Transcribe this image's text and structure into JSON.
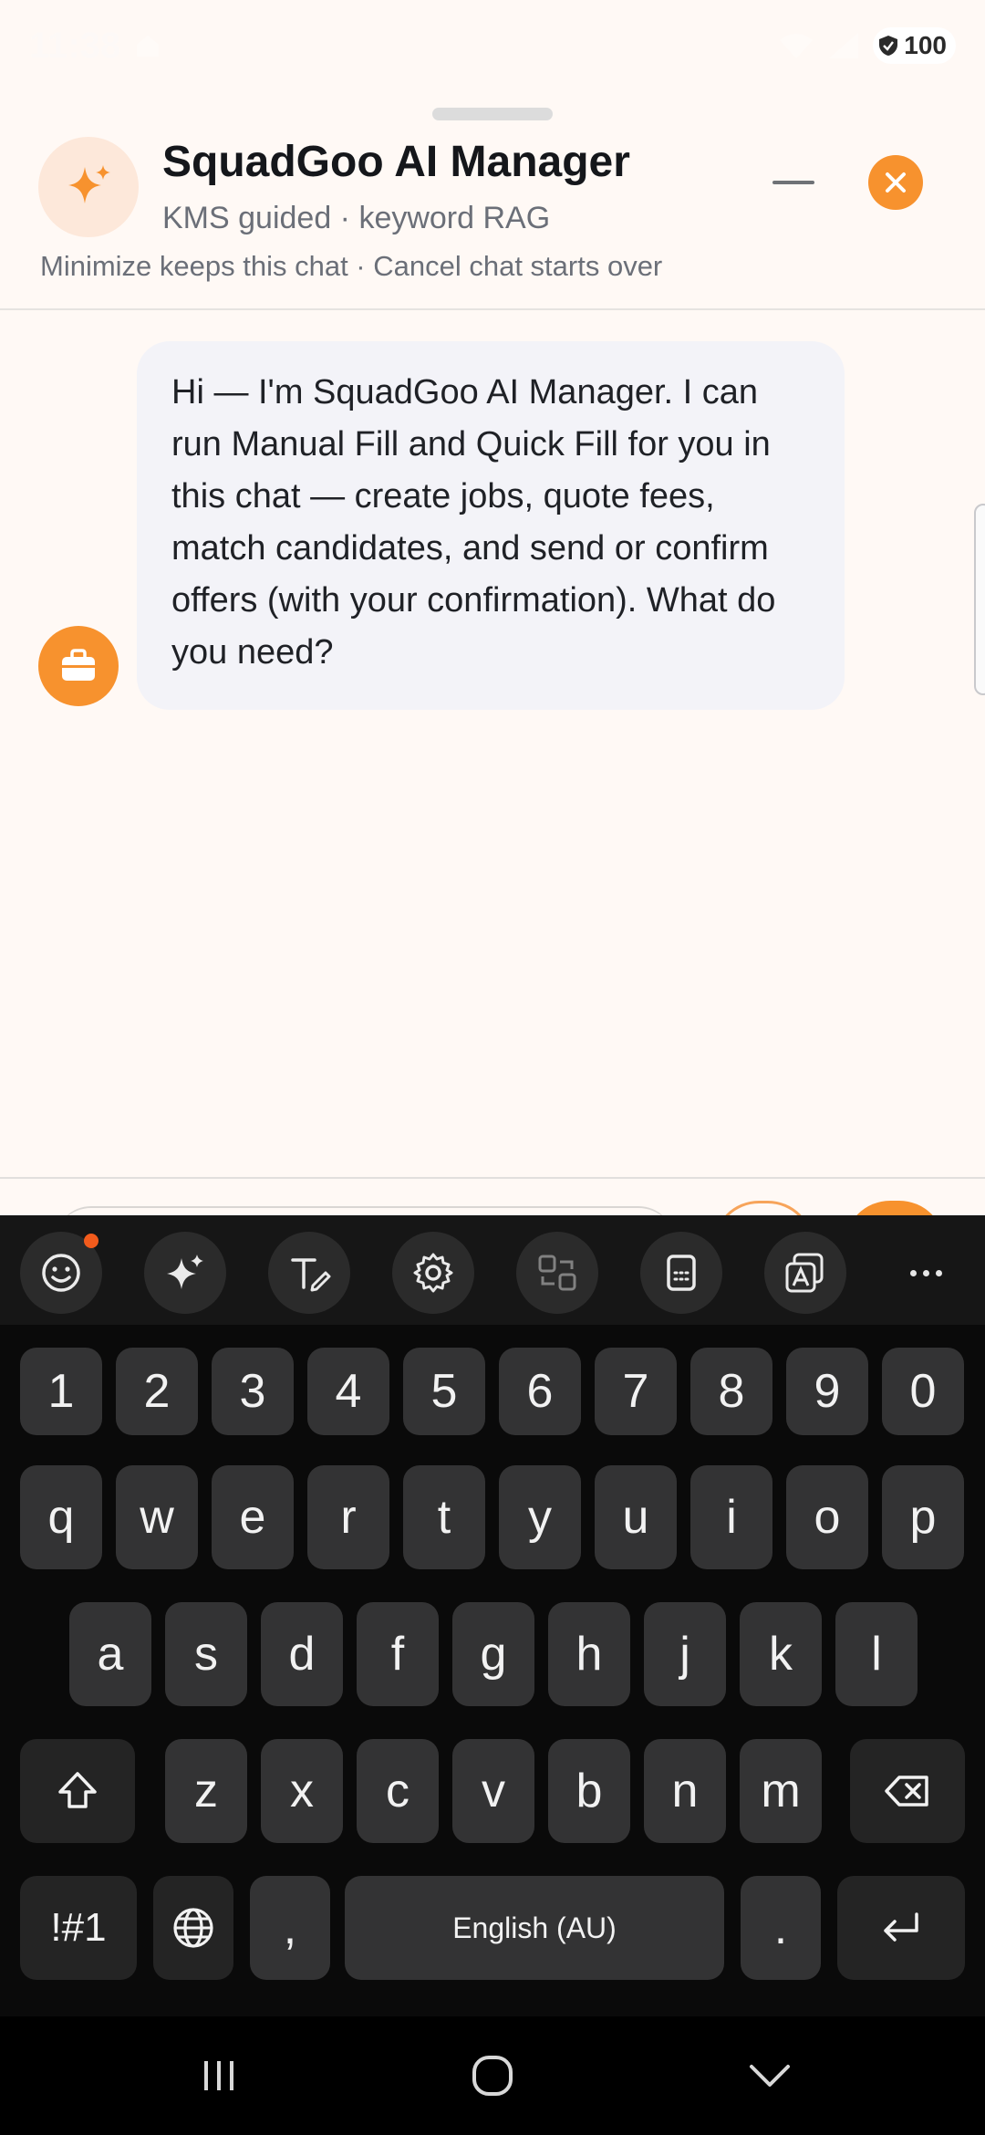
{
  "status_bar": {
    "time": "11:38",
    "battery_level": "100"
  },
  "header": {
    "title": "SquadGoo AI Manager",
    "subtitle": "KMS guided · keyword RAG",
    "hint": "Minimize keeps this chat · Cancel chat starts over",
    "icons": {
      "avatar": "sparkles-icon",
      "minimize": "minimize-icon",
      "close": "close-icon"
    }
  },
  "chat": {
    "messages": [
      {
        "sender": "bot",
        "avatar_icon": "briefcase-icon",
        "text": "Hi — I'm SquadGoo AI Manager. I can run Manual Fill and Quick Fill for you in this chat — create jobs, quote fees, match candidates, and send or confirm offers (with your confirmation). What do you need?"
      }
    ]
  },
  "keyboard": {
    "toolbar": [
      "emoji-icon",
      "ai-sparkle-icon",
      "handwriting-icon",
      "settings-icon",
      "translate-icon",
      "clipboard-icon",
      "text-recognition-icon",
      "more-icon"
    ],
    "number_row": [
      "1",
      "2",
      "3",
      "4",
      "5",
      "6",
      "7",
      "8",
      "9",
      "0"
    ],
    "row1": [
      "q",
      "w",
      "e",
      "r",
      "t",
      "y",
      "u",
      "i",
      "o",
      "p"
    ],
    "row2": [
      "a",
      "s",
      "d",
      "f",
      "g",
      "h",
      "j",
      "k",
      "l"
    ],
    "row3": [
      "z",
      "x",
      "c",
      "v",
      "b",
      "n",
      "m"
    ],
    "symbols_label": "!#1",
    "comma_label": ",",
    "space_label": "English (AU)",
    "period_label": ".",
    "colors": {
      "background": "#0a0a0a",
      "key": "#333334",
      "accent": "#f7922e"
    }
  },
  "navigation": [
    "recents-icon",
    "home-icon",
    "back-icon"
  ]
}
